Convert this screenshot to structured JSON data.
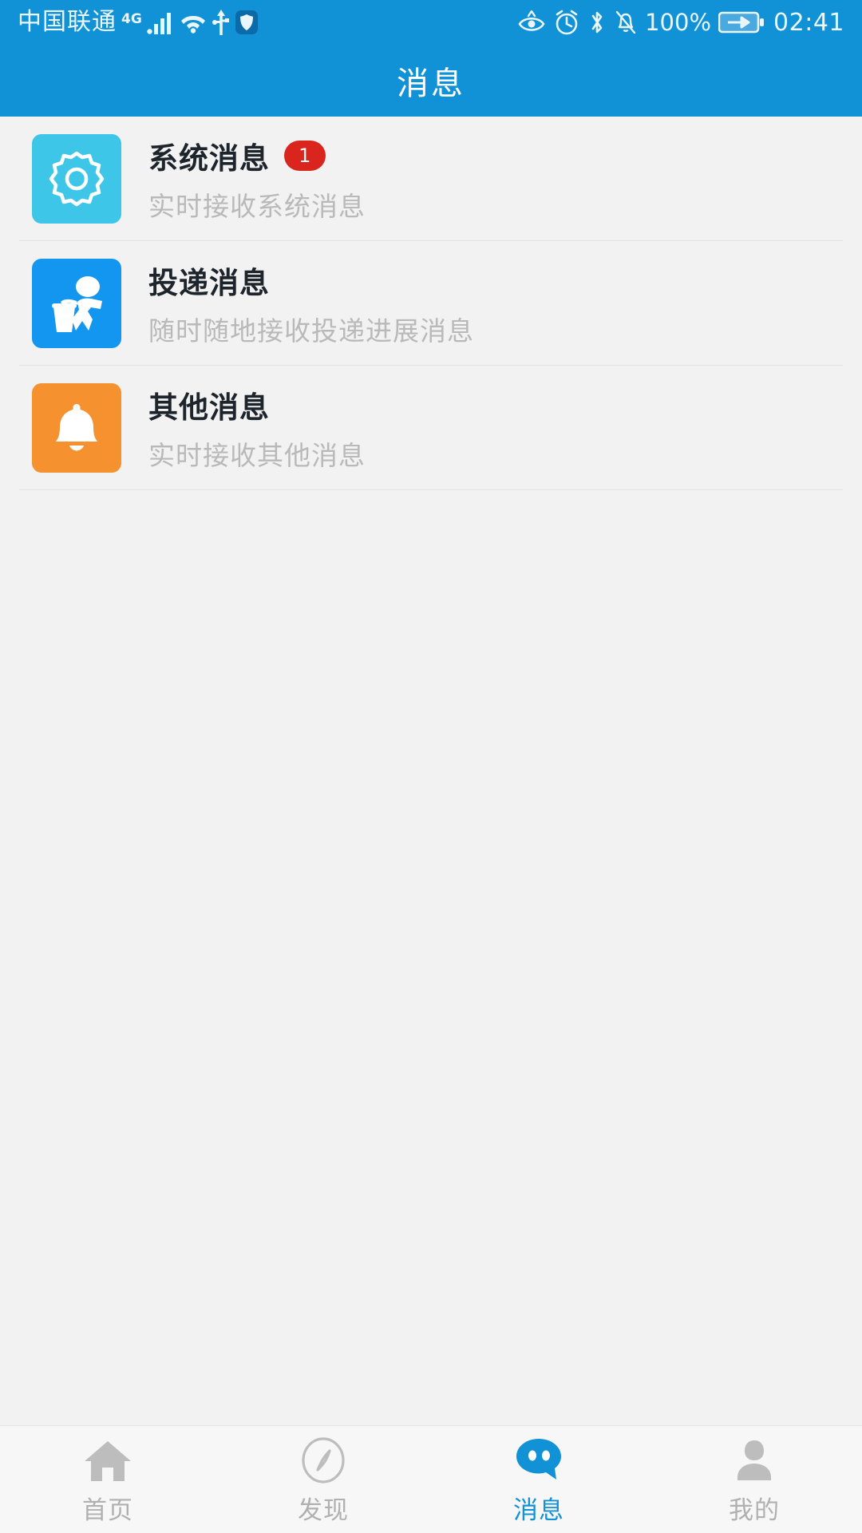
{
  "theme": {
    "primary": "#1191d6",
    "page_bg": "#f2f2f2",
    "badge_bg": "#d9251d",
    "tab_active": "#1191d6",
    "tab_inactive": "#b0b0b0"
  },
  "statusbar": {
    "carrier": "中国联通",
    "network_type": "4G",
    "icons_left": [
      "signal-bars-icon",
      "wifi-icon",
      "usb-icon",
      "shield-icon"
    ],
    "icons_right": [
      "eye-icon",
      "alarm-clock-icon",
      "bluetooth-icon",
      "bell-muted-icon"
    ],
    "battery_percent": "100%",
    "battery_icon": "battery-charging-icon",
    "time": "02:41"
  },
  "header": {
    "title": "消息"
  },
  "main": {
    "items": [
      {
        "icon": "gear-icon",
        "icon_bg": "#3ec6e8",
        "title": "系统消息",
        "badge": "1",
        "subtitle": "实时接收系统消息"
      },
      {
        "icon": "delivery-person-icon",
        "icon_bg": "#1296f0",
        "title": "投递消息",
        "badge": "",
        "subtitle": "随时随地接收投递进展消息"
      },
      {
        "icon": "bell-icon",
        "icon_bg": "#f5922f",
        "title": "其他消息",
        "badge": "",
        "subtitle": "实时接收其他消息"
      }
    ]
  },
  "tabbar": {
    "tabs": [
      {
        "icon": "home-icon",
        "label": "首页",
        "active": false
      },
      {
        "icon": "compass-icon",
        "label": "发现",
        "active": false
      },
      {
        "icon": "chat-bubble-icon",
        "label": "消息",
        "active": true
      },
      {
        "icon": "person-icon",
        "label": "我的",
        "active": false
      }
    ]
  }
}
